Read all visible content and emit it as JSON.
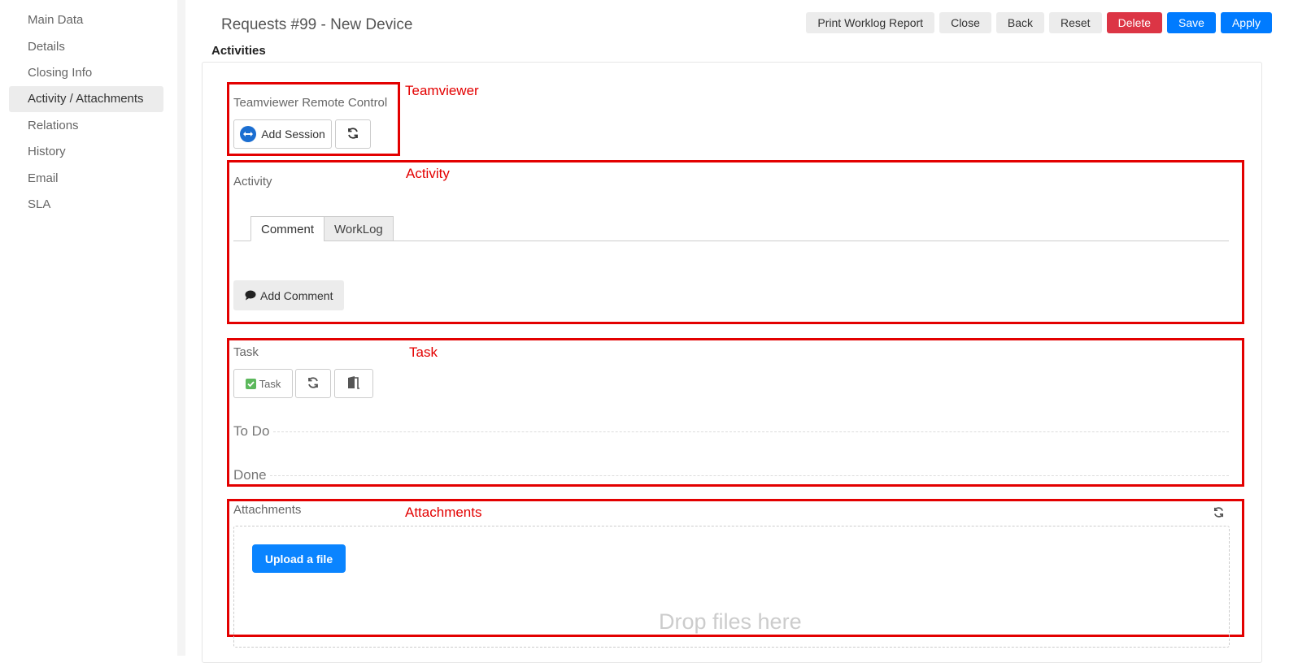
{
  "sidebar": {
    "items": [
      {
        "label": "Main Data"
      },
      {
        "label": "Details"
      },
      {
        "label": "Closing Info"
      },
      {
        "label": "Activity / Attachments",
        "active": true
      },
      {
        "label": "Relations"
      },
      {
        "label": "History"
      },
      {
        "label": "Email"
      },
      {
        "label": "SLA"
      }
    ]
  },
  "header": {
    "title": "Requests #99 - New Device",
    "buttons": {
      "print": "Print Worklog Report",
      "close": "Close",
      "back": "Back",
      "reset": "Reset",
      "delete": "Delete",
      "save": "Save",
      "apply": "Apply"
    }
  },
  "section_title": "Activities",
  "teamviewer": {
    "annotation": "Teamviewer",
    "label": "Teamviewer Remote Control",
    "add_session": "Add Session",
    "refresh_icon": "refresh-icon"
  },
  "activity": {
    "annotation": "Activity",
    "label": "Activity",
    "tabs": [
      {
        "label": "Comment",
        "active": true
      },
      {
        "label": "WorkLog",
        "active": false
      }
    ],
    "add_comment": "Add Comment"
  },
  "task": {
    "annotation": "Task",
    "label": "Task",
    "task_button": "Task",
    "todo": "To Do",
    "done": "Done"
  },
  "attachments": {
    "annotation": "Attachments",
    "label": "Attachments",
    "upload": "Upload a file",
    "drop_text": "Drop files here"
  },
  "colors": {
    "primary": "#007bff",
    "danger": "#dc3545",
    "annotation": "#e30000"
  }
}
